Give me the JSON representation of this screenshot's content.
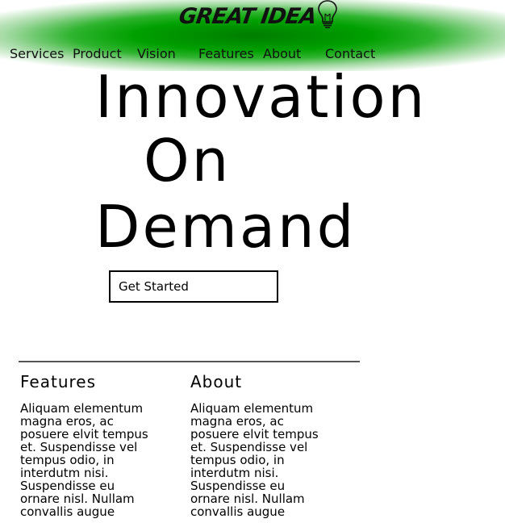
{
  "header": {
    "logo_text": "GREAT IDEA",
    "logo_icon": "lightbulb-icon",
    "background_color": "#008c00"
  },
  "nav": {
    "items": [
      "Services",
      "Product",
      "Vision",
      "Features",
      "About",
      "Contact"
    ]
  },
  "hero": {
    "lines": [
      "Innovation",
      "On",
      "Demand"
    ],
    "cta_label": "Get Started"
  },
  "columns": [
    {
      "heading": "Features",
      "body": "Aliquam elementum magna eros, ac posuere elvit tempus et. Suspendisse vel tempus odio, in interdutm nisi. Suspendisse eu ornare nisl. Nullam convallis augue"
    },
    {
      "heading": "About",
      "body": "Aliquam elementum magna eros, ac posuere elvit tempus et. Suspendisse vel tempus odio, in interdutm nisi. Suspendisse eu ornare nisl. Nullam convallis augue"
    }
  ]
}
